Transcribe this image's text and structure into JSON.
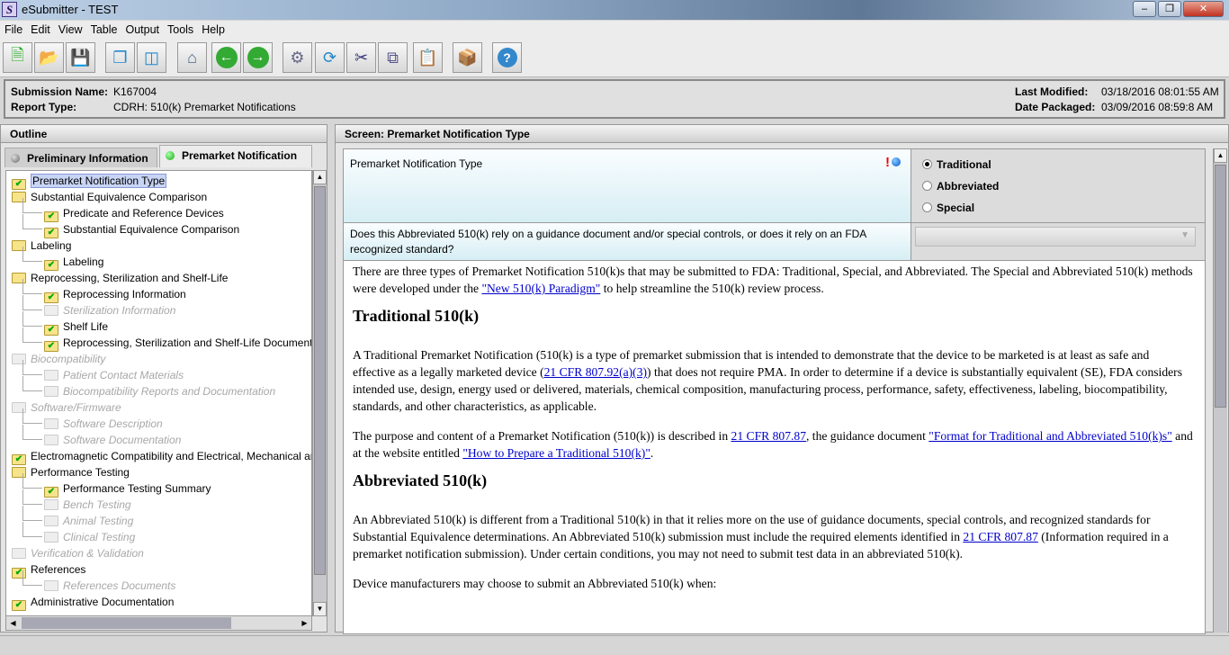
{
  "window": {
    "title": "eSubmitter - TEST",
    "icon_letter": "S"
  },
  "menu": [
    "File",
    "Edit",
    "View",
    "Table",
    "Output",
    "Tools",
    "Help"
  ],
  "toolbar": [
    "new-document-icon",
    "open-folder-icon",
    "save-icon",
    "cascade-windows-icon",
    "split-view-icon",
    "home-icon",
    "back-arrow-icon",
    "forward-arrow-icon",
    "gears-run-icon",
    "refresh-icon",
    "cut-icon",
    "copy-icon",
    "paste-icon",
    "package-icon",
    "help-icon"
  ],
  "info": {
    "submission_name_label": "Submission Name:",
    "submission_name": "K167004",
    "report_type_label": "Report Type:",
    "report_type": "CDRH: 510(k) Premarket Notifications",
    "last_modified_label": "Last Modified:",
    "last_modified": "03/18/2016 08:01:55 AM",
    "date_packaged_label": "Date Packaged:",
    "date_packaged": "03/09/2016 08:59:8 AM"
  },
  "outline": {
    "title": "Outline",
    "tabs": [
      "Preliminary Information",
      "Premarket Notification"
    ],
    "items": [
      {
        "label": "Premarket Notification Type",
        "level": 0,
        "state": "done",
        "selected": true
      },
      {
        "label": "Substantial Equivalence Comparison",
        "level": 0,
        "state": "open"
      },
      {
        "label": "Predicate and Reference Devices",
        "level": 1,
        "state": "done"
      },
      {
        "label": "Substantial Equivalence Comparison",
        "level": 1,
        "state": "done"
      },
      {
        "label": "Labeling",
        "level": 0,
        "state": "open"
      },
      {
        "label": "Labeling",
        "level": 1,
        "state": "done"
      },
      {
        "label": "Reprocessing, Sterilization and Shelf-Life",
        "level": 0,
        "state": "open"
      },
      {
        "label": "Reprocessing Information",
        "level": 1,
        "state": "done"
      },
      {
        "label": "Sterilization Information",
        "level": 1,
        "state": "disabled"
      },
      {
        "label": "Shelf Life",
        "level": 1,
        "state": "done"
      },
      {
        "label": "Reprocessing, Sterilization and Shelf-Life Documentation",
        "level": 1,
        "state": "done"
      },
      {
        "label": "Biocompatibility",
        "level": 0,
        "state": "disabled"
      },
      {
        "label": "Patient Contact Materials",
        "level": 1,
        "state": "disabled"
      },
      {
        "label": "Biocompatibility Reports and Documentation",
        "level": 1,
        "state": "disabled"
      },
      {
        "label": "Software/Firmware",
        "level": 0,
        "state": "disabled"
      },
      {
        "label": "Software Description",
        "level": 1,
        "state": "disabled"
      },
      {
        "label": "Software Documentation",
        "level": 1,
        "state": "disabled"
      },
      {
        "label": "Electromagnetic Compatibility and Electrical, Mechanical and Thermal Safety",
        "level": 0,
        "state": "done"
      },
      {
        "label": "Performance Testing",
        "level": 0,
        "state": "open"
      },
      {
        "label": "Performance Testing Summary",
        "level": 1,
        "state": "done"
      },
      {
        "label": "Bench Testing",
        "level": 1,
        "state": "disabled"
      },
      {
        "label": "Animal Testing",
        "level": 1,
        "state": "disabled"
      },
      {
        "label": "Clinical Testing",
        "level": 1,
        "state": "disabled"
      },
      {
        "label": "Verification & Validation",
        "level": 0,
        "state": "disabled"
      },
      {
        "label": "References",
        "level": 0,
        "state": "done"
      },
      {
        "label": "References Documents",
        "level": 1,
        "state": "disabled"
      },
      {
        "label": "Administrative Documentation",
        "level": 0,
        "state": "done"
      }
    ]
  },
  "screen": {
    "title": "Screen: Premarket Notification Type",
    "q1": {
      "label": "Premarket Notification Type",
      "options": [
        "Traditional",
        "Abbreviated",
        "Special"
      ],
      "selected": "Traditional",
      "required_mark": "!"
    },
    "q2": {
      "label": "Does this Abbreviated 510(k) rely on a guidance document and/or special controls, or does it rely on an FDA recognized standard?",
      "value": ""
    },
    "content": {
      "intro_1": "There are three types of Premarket Notification 510(k)s that may be submitted to FDA: Traditional, Special, and Abbreviated. The Special and Abbreviated 510(k) methods were developed under the ",
      "intro_link": "\"New 510(k) Paradigm\"",
      "intro_2": " to help streamline the 510(k) review process.",
      "h_trad": "Traditional 510(k)",
      "trad_1": "A Traditional Premarket Notification (510(k) is a type of premarket submission that is intended to demonstrate that the device to be marketed is at least as safe and effective as a legally marketed device (",
      "trad_link": "21 CFR 807.92(a)(3)",
      "trad_2": ") that does not require PMA. In order to determine if a device is substantially equivalent (SE), FDA considers intended use, design, energy used or delivered, materials, chemical composition, manufacturing process, performance, safety, effectiveness, labeling, biocompatibility, standards, and other characteristics, as applicable.",
      "purpose_1": "The purpose and content of a Premarket Notification (510(k)) is described in ",
      "purpose_link1": "21 CFR 807.87",
      "purpose_2": ", the guidance document ",
      "purpose_link2": "\"Format for Traditional and Abbreviated 510(k)s\"",
      "purpose_3": " and at the website entitled ",
      "purpose_link3": "\"How to Prepare a Traditional 510(k)\"",
      "purpose_4": ".",
      "h_abbr": "Abbreviated 510(k)",
      "abbr_1": "An Abbreviated 510(k) is different from a Traditional 510(k) in that it relies more on the use of guidance documents, special controls, and recognized standards for Substantial Equivalence determinations. An Abbreviated 510(k) submission must include the required elements identified in ",
      "abbr_link": "21 CFR 807.87",
      "abbr_2": " (Information required in a premarket notification submission). Under certain conditions, you may not need to submit test data in an abbreviated 510(k).",
      "manuf": "Device manufacturers may choose to submit an Abbreviated 510(k) when:"
    }
  }
}
